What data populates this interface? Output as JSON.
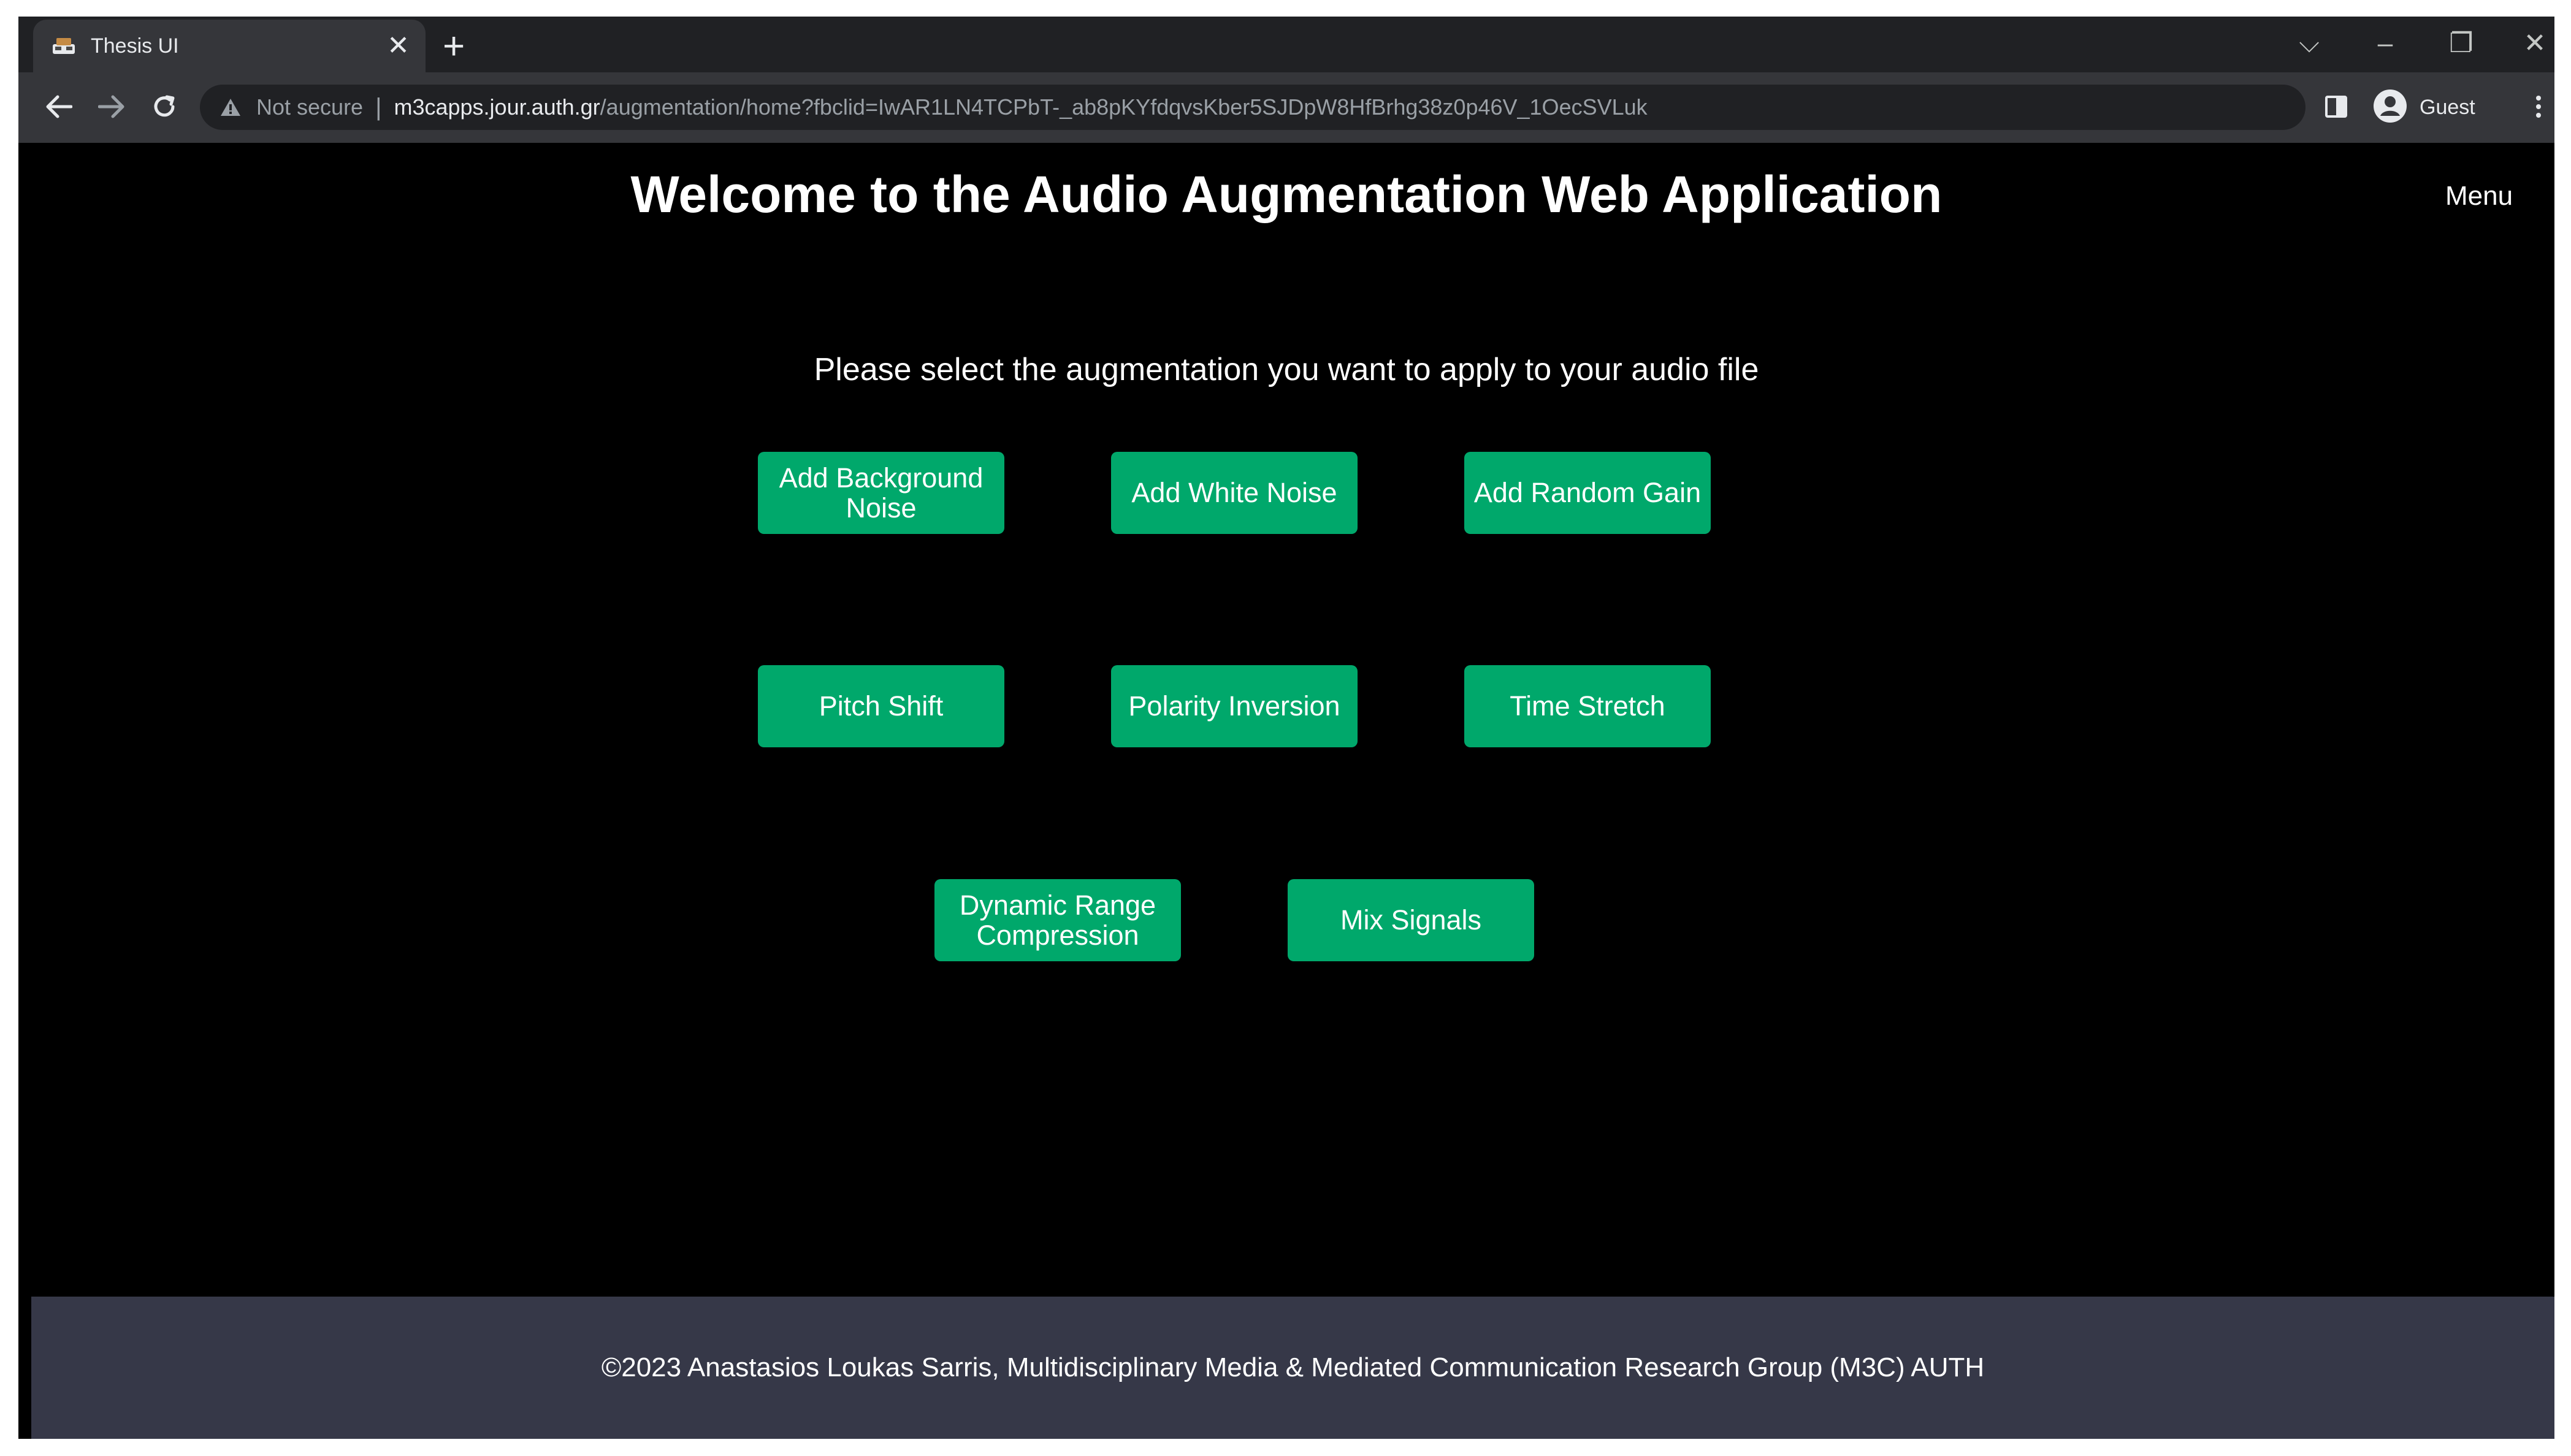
{
  "browser": {
    "tab_title": "Thesis UI",
    "tab_close_glyph": "✕",
    "new_tab_glyph": "+",
    "security_label": "Not secure",
    "separator": "|",
    "url_host": "m3capps.jour.auth.gr",
    "url_path": "/augmentation/home?fbclid=IwAR1LN4TCPbT-_ab8pKYfdqvsKber5SJDpW8HfBrhg38z0p46V_1OecSVLuk",
    "profile_label": "Guest",
    "icons": [
      "tab-favicon",
      "new-tab-icon",
      "tab-search-icon",
      "minimize-icon",
      "restore-icon",
      "close-window-icon",
      "back-icon",
      "forward-icon",
      "reload-icon",
      "warning-icon",
      "side-panel-icon",
      "profile-avatar-icon",
      "kebab-menu-icon"
    ],
    "glyphs": {
      "tab_search": "⌵",
      "minimize": "–",
      "restore": "❐",
      "close_window": "✕"
    }
  },
  "page": {
    "title": "Welcome to the Audio Augmentation Web Application",
    "menu_label": "Menu",
    "prompt": "Please select the augmentation you want to apply to your audio file",
    "buttons": {
      "background_noise": "Add Background Noise",
      "white_noise": "Add White Noise",
      "random_gain": "Add Random Gain",
      "pitch_shift": "Pitch Shift",
      "polarity_inversion": "Polarity Inversion",
      "time_stretch": "Time Stretch",
      "dynamic_range_compression": "Dynamic Range Compression",
      "mix_signals": "Mix Signals"
    },
    "footer": "©2023 Anastasios Loukas Sarris, Multidisciplinary Media & Mediated Communication Research Group (M3C) AUTH"
  },
  "colors": {
    "page_background": "#000000",
    "button": "#00a86b",
    "footer": "#363848",
    "browser_frame": "#202124",
    "toolbar": "#35363a"
  }
}
